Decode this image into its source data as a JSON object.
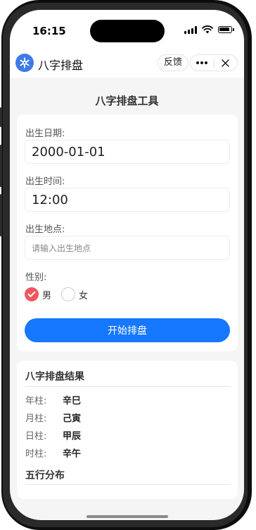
{
  "status_bar": {
    "time": "16:15"
  },
  "navbar": {
    "app_name": "八字排盘",
    "feedback_label": "反馈",
    "logo_icon": "snowflake-icon",
    "more_icon": "more-dots-icon",
    "close_icon": "close-icon"
  },
  "page": {
    "title": "八字排盘工具"
  },
  "form": {
    "birth_date": {
      "label": "出生日期:",
      "value": "2000-01-01"
    },
    "birth_time": {
      "label": "出生时间:",
      "value": "12:00"
    },
    "birth_place": {
      "label": "出生地点:",
      "placeholder": "请输入出生地点"
    },
    "gender": {
      "label": "性别:",
      "options": [
        {
          "label": "男",
          "selected": true
        },
        {
          "label": "女",
          "selected": false
        }
      ]
    },
    "submit_label": "开始排盘"
  },
  "results": {
    "title": "八字排盘结果",
    "pillars": [
      {
        "label": "年柱:",
        "value": "辛巳"
      },
      {
        "label": "月柱:",
        "value": "己寅"
      },
      {
        "label": "日柱:",
        "value": "甲辰"
      },
      {
        "label": "时柱:",
        "value": "辛午"
      }
    ],
    "five_elements_title": "五行分布"
  },
  "colors": {
    "accent": "#1677ff",
    "selected_radio": "#f0575e",
    "logo": "#3d7be6"
  }
}
